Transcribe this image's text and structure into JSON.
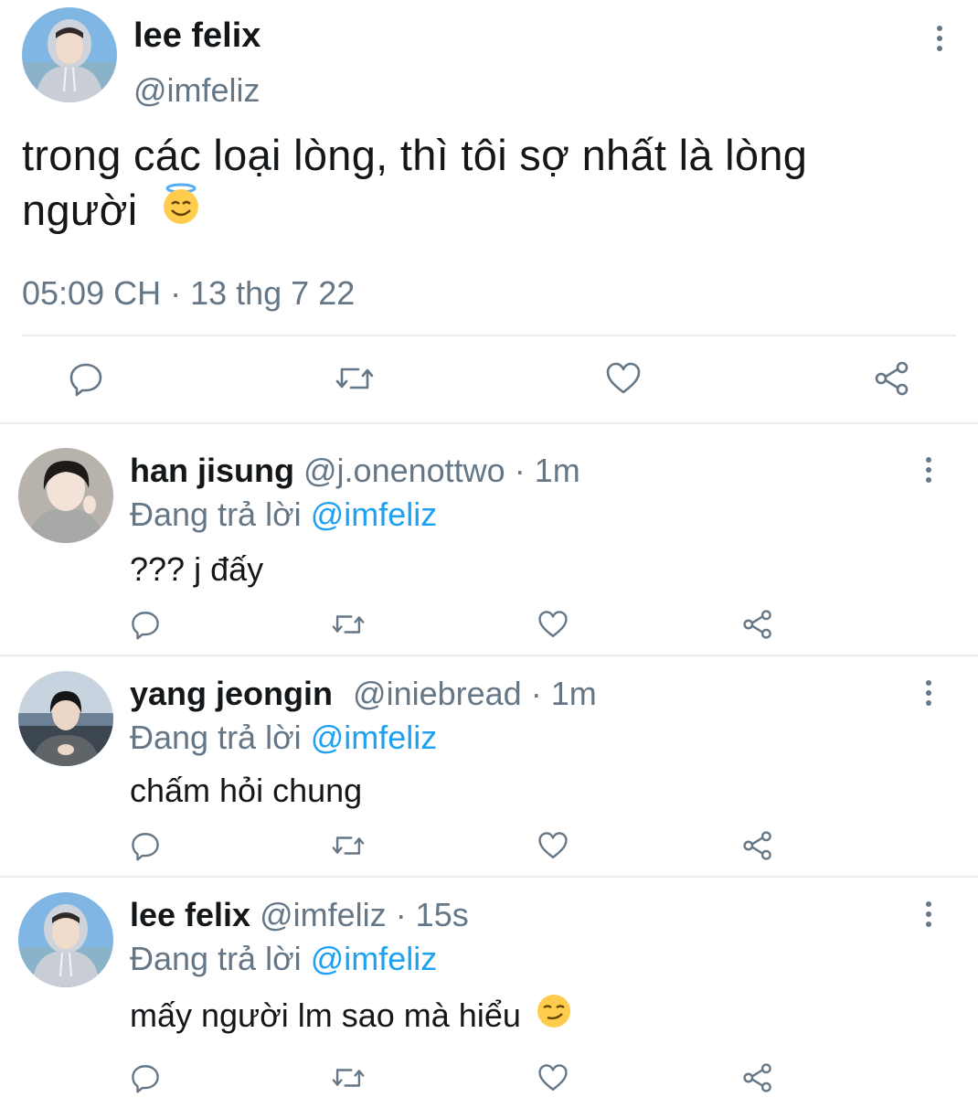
{
  "main_tweet": {
    "author_name": "lee felix",
    "author_handle": "@imfeliz",
    "text": "trong các loại lòng, thì tôi sợ nhất là lòng người",
    "text_line1": "trong các loại lòng, thì tôi sợ nhất là lòng",
    "text_line2": "người",
    "emoji": "smiling-face-with-halo",
    "timestamp": "05:09 CH · 13 thg 7 22"
  },
  "replies": [
    {
      "author_name": "han jisung",
      "author_handle": "@j.onenottwo",
      "time": "· 1m",
      "replying_prefix": "Đang trả lời",
      "replying_to": "@imfeliz",
      "text": "??? j đấy"
    },
    {
      "author_name": "yang jeongin",
      "author_handle": "@iniebread",
      "time": "· 1m",
      "replying_prefix": "Đang trả lời",
      "replying_to": "@imfeliz",
      "text": "chấm hỏi chung"
    },
    {
      "author_name": "lee felix",
      "author_handle": "@imfeliz",
      "time": "· 15s",
      "replying_prefix": "Đang trả lời",
      "replying_to": "@imfeliz",
      "text": "mấy người lm sao mà hiểu",
      "emoji": "smirking-face"
    }
  ],
  "colors": {
    "text": "#14171a",
    "secondary": "#657786",
    "link": "#1da1f2",
    "divider": "#e6ecf0",
    "icon": "#657786"
  }
}
